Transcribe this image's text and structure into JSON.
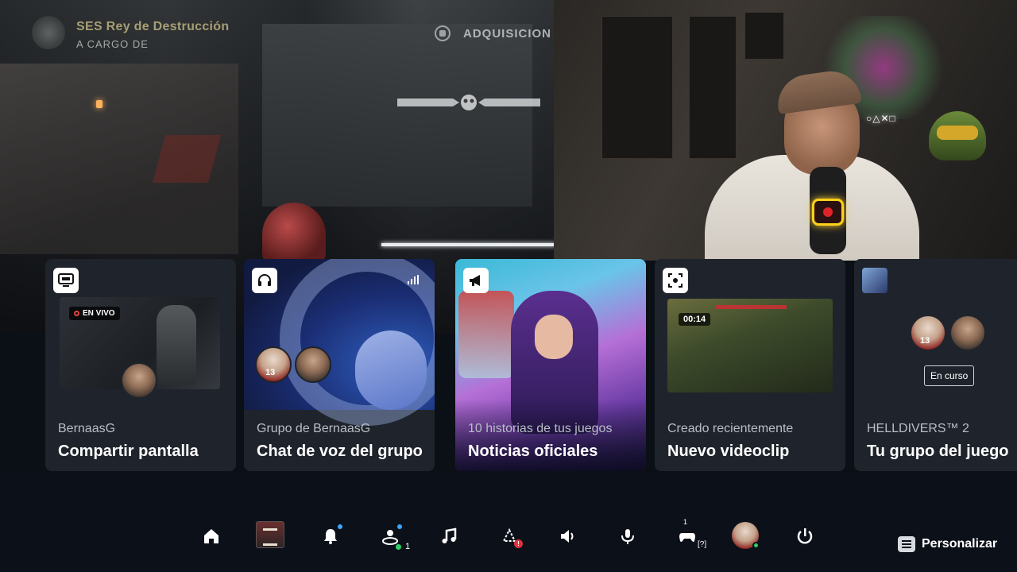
{
  "game_hud": {
    "mission_title": "SES Rey de Destrucción",
    "mission_subtitle": "A CARGO DE",
    "menu_label": "ADQUISICION"
  },
  "webcam": {
    "sign_text": "○△✕□"
  },
  "cards": [
    {
      "badge_icon": "screen-share-icon",
      "live_label": "EN VIVO",
      "subtitle": "BernaasG",
      "title": "Compartir pantalla"
    },
    {
      "badge_icon": "headset-icon",
      "subtitle": "Grupo de BernaasG",
      "title": "Chat de voz del grupo"
    },
    {
      "badge_icon": "megaphone-icon",
      "subtitle": "10 historias de tus juegos",
      "title": "Noticias oficiales"
    },
    {
      "badge_icon": "capture-icon",
      "clip_duration": "00:14",
      "subtitle": "Creado recientemente",
      "title": "Nuevo videoclip"
    },
    {
      "badge_icon": "game-thumbnail-icon",
      "status": "En curso",
      "subtitle": "HELLDIVERS™ 2",
      "title": "Tu grupo del juego"
    }
  ],
  "control_bar": {
    "items": [
      {
        "icon": "home-icon"
      },
      {
        "icon": "game-base-icon"
      },
      {
        "icon": "notifications-icon"
      },
      {
        "icon": "friends-icon",
        "online_count": "1"
      },
      {
        "icon": "music-icon"
      },
      {
        "icon": "playstation-plus-icon"
      },
      {
        "icon": "sound-icon"
      },
      {
        "icon": "microphone-icon"
      },
      {
        "icon": "controller-icon",
        "controller_number": "1",
        "controller_status": "[?]"
      },
      {
        "icon": "profile-avatar"
      },
      {
        "icon": "power-icon"
      }
    ],
    "customize_label": "Personalizar"
  },
  "colors": {
    "background": "#0c1119",
    "card": "#1f242c",
    "notification_dot": "#3ea6ff",
    "online_dot": "#2fd06a",
    "alert": "#e0313d"
  }
}
